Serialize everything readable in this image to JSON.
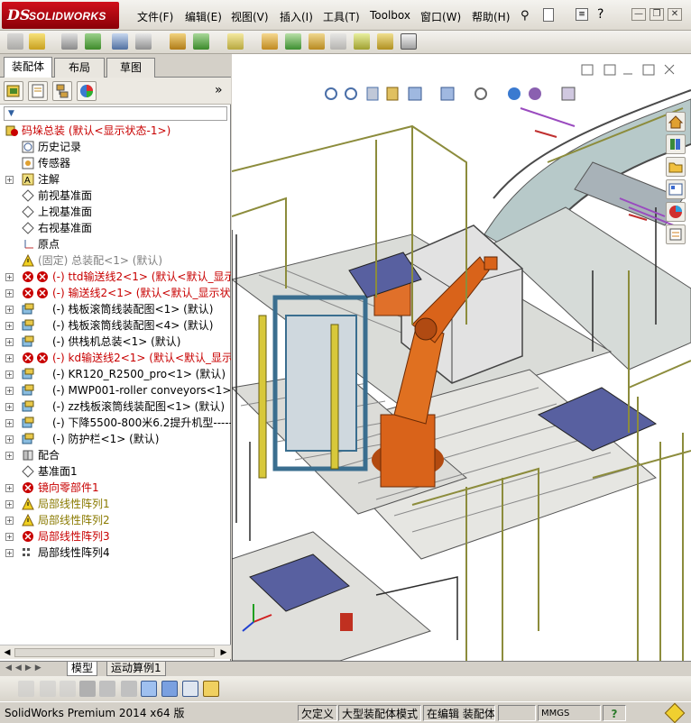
{
  "window": {
    "logo_ds": "DS",
    "logo_text": "SOLIDWORKS",
    "menus": [
      "文件(F)",
      "编辑(E)",
      "视图(V)",
      "插入(I)",
      "工具(T)",
      "Toolbox",
      "窗口(W)",
      "帮助(H)"
    ],
    "help_glyph": "?",
    "search_glyph": "⚲",
    "min_glyph": "—",
    "restore_glyph": "❐",
    "close_glyph": "✕"
  },
  "panel": {
    "tabs": [
      "装配体",
      "布局",
      "草图"
    ],
    "fm_expand": "»",
    "filter_glyph": "▼"
  },
  "tree": [
    {
      "text": "码垛总装  (默认<显示状态-1>)",
      "color": "red",
      "icon": "assembly-error-icon",
      "exp": ""
    },
    {
      "text": "历史记录",
      "color": "black",
      "icon": "history-icon",
      "exp": ""
    },
    {
      "text": "传感器",
      "color": "black",
      "icon": "sensor-icon",
      "exp": ""
    },
    {
      "text": "注解",
      "color": "black",
      "icon": "annotation-icon",
      "exp": "+"
    },
    {
      "text": "前视基准面",
      "color": "black",
      "icon": "plane-icon",
      "exp": ""
    },
    {
      "text": "上视基准面",
      "color": "black",
      "icon": "plane-icon",
      "exp": ""
    },
    {
      "text": "右视基准面",
      "color": "black",
      "icon": "plane-icon",
      "exp": ""
    },
    {
      "text": "原点",
      "color": "black",
      "icon": "origin-icon",
      "exp": ""
    },
    {
      "text": "(固定) 总装配<1> (默认)",
      "color": "gray",
      "icon": "warning-icon",
      "exp": ""
    },
    {
      "text": "(-) ttd输送线2<1> (默认<默认_显示",
      "color": "red",
      "icon": "error-icon",
      "exp": "+"
    },
    {
      "text": "(-) 输送线2<1> (默认<默认_显示状",
      "color": "red",
      "icon": "error-icon",
      "exp": "+"
    },
    {
      "text": "(-) 栈板滚筒线装配图<1> (默认)",
      "color": "black",
      "icon": "subassembly-icon",
      "exp": "+"
    },
    {
      "text": "(-) 栈板滚筒线装配图<4> (默认)",
      "color": "black",
      "icon": "subassembly-icon",
      "exp": "+"
    },
    {
      "text": "(-) 供栈机总装<1> (默认)",
      "color": "black",
      "icon": "subassembly-icon",
      "exp": "+"
    },
    {
      "text": "(-) kd输送线2<1> (默认<默认_显示",
      "color": "red",
      "icon": "error-icon",
      "exp": "+"
    },
    {
      "text": "(-) KR120_R2500_pro<1> (默认)",
      "color": "black",
      "icon": "subassembly-icon",
      "exp": "+"
    },
    {
      "text": "(-) MWP001-roller conveyors<1> (默认",
      "color": "black",
      "icon": "subassembly-icon",
      "exp": "+"
    },
    {
      "text": "(-) zz栈板滚筒线装配图<1> (默认)",
      "color": "black",
      "icon": "subassembly-icon",
      "exp": "+"
    },
    {
      "text": "(-) 下降5500-800米6.2提升机型-------",
      "color": "black",
      "icon": "subassembly-icon",
      "exp": "+"
    },
    {
      "text": "(-) 防护栏<1> (默认)",
      "color": "black",
      "icon": "subassembly-icon",
      "exp": "+"
    },
    {
      "text": "配合",
      "color": "black",
      "icon": "mates-icon",
      "exp": "+"
    },
    {
      "text": "基准面1",
      "color": "black",
      "icon": "plane-icon",
      "exp": ""
    },
    {
      "text": "镜向零部件1",
      "color": "red",
      "icon": "error-icon",
      "exp": "+"
    },
    {
      "text": "局部线性阵列1",
      "color": "olive",
      "icon": "warning-icon",
      "exp": "+"
    },
    {
      "text": "局部线性阵列2",
      "color": "olive",
      "icon": "warning-icon",
      "exp": "+"
    },
    {
      "text": "局部线性阵列3",
      "color": "red",
      "icon": "error-icon",
      "exp": "+"
    },
    {
      "text": "局部线性阵列4",
      "color": "black",
      "icon": "pattern-icon",
      "exp": "+"
    }
  ],
  "bottom_tabs": [
    "模型",
    "运动算例1"
  ],
  "status": {
    "app": "SolidWorks Premium 2014 x64 版",
    "f1": "欠定义",
    "f2": "大型装配体模式",
    "f3": "在编辑 装配体",
    "units": "MMGS",
    "help": "?"
  },
  "colors": {
    "error_red": "#c80000",
    "warning_olive": "#8a7a00",
    "robot_orange": "#d9631a",
    "frame_olive": "#8c8c3c",
    "frame_blue": "#3a6e8f"
  }
}
